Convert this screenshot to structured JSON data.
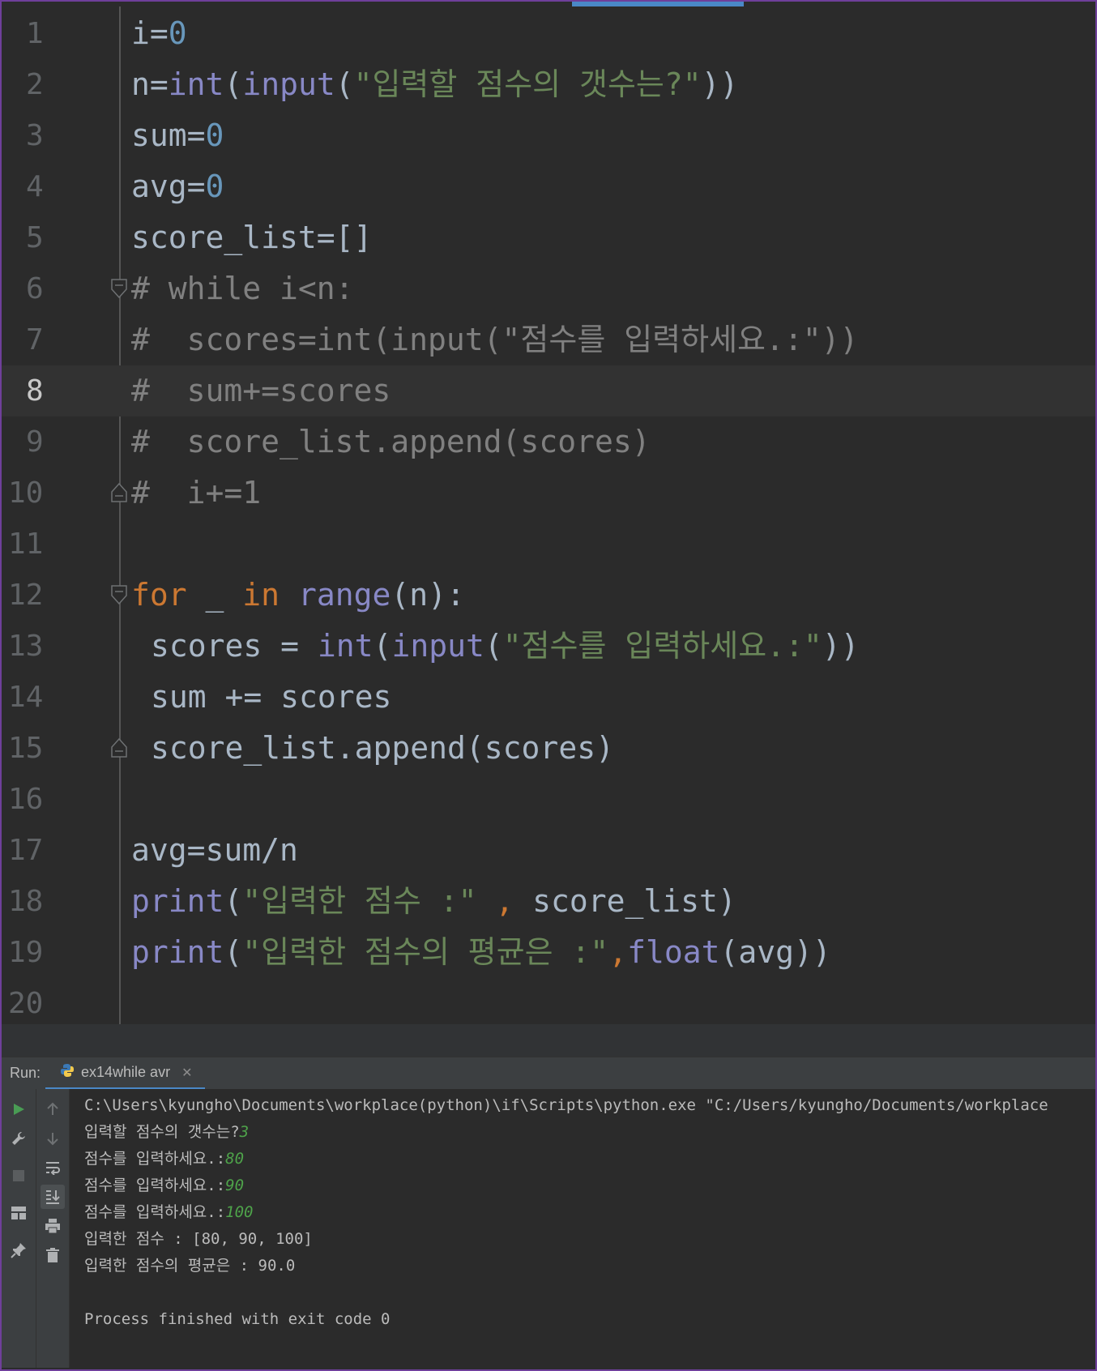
{
  "editor": {
    "current_line": 8,
    "lines": [
      {
        "n": "1",
        "tokens": [
          [
            "i",
            "p"
          ],
          [
            "=",
            "p"
          ],
          [
            "0",
            "num"
          ]
        ]
      },
      {
        "n": "2",
        "tokens": [
          [
            "n",
            "p"
          ],
          [
            "=",
            "p"
          ],
          [
            "int",
            "bi"
          ],
          [
            "(",
            "p"
          ],
          [
            "input",
            "bi"
          ],
          [
            "(",
            "p"
          ],
          [
            "\"입력할 점수의 갯수는?\"",
            "str"
          ],
          [
            "))",
            "p"
          ]
        ]
      },
      {
        "n": "3",
        "tokens": [
          [
            "sum",
            "p"
          ],
          [
            "=",
            "p"
          ],
          [
            "0",
            "num"
          ]
        ]
      },
      {
        "n": "4",
        "tokens": [
          [
            "avg",
            "p"
          ],
          [
            "=",
            "p"
          ],
          [
            "0",
            "num"
          ]
        ]
      },
      {
        "n": "5",
        "tokens": [
          [
            "score_list",
            "p"
          ],
          [
            "=[]",
            "p"
          ]
        ]
      },
      {
        "n": "6",
        "tokens": [
          [
            "# while i<n:",
            "cm"
          ]
        ]
      },
      {
        "n": "7",
        "tokens": [
          [
            "#  scores=int(input(\"점수를 입력하세요.:\"))",
            "cm"
          ]
        ]
      },
      {
        "n": "8",
        "tokens": [
          [
            "#  sum+=scores",
            "cm"
          ]
        ]
      },
      {
        "n": "9",
        "tokens": [
          [
            "#  score_list.append(scores)",
            "cm"
          ]
        ]
      },
      {
        "n": "10",
        "tokens": [
          [
            "#  i+=1",
            "cm"
          ]
        ]
      },
      {
        "n": "11",
        "tokens": []
      },
      {
        "n": "12",
        "tokens": [
          [
            "for",
            "kw"
          ],
          [
            " _ ",
            "p"
          ],
          [
            "in",
            "kw"
          ],
          [
            " ",
            "p"
          ],
          [
            "range",
            "bi"
          ],
          [
            "(n):",
            "p"
          ]
        ]
      },
      {
        "n": "13",
        "indent": true,
        "tokens": [
          [
            "scores = ",
            "p"
          ],
          [
            "int",
            "bi"
          ],
          [
            "(",
            "p"
          ],
          [
            "input",
            "bi"
          ],
          [
            "(",
            "p"
          ],
          [
            "\"점수를 입력하세요.:\"",
            "str"
          ],
          [
            "))",
            "p"
          ]
        ]
      },
      {
        "n": "14",
        "indent": true,
        "tokens": [
          [
            "sum += scores",
            "p"
          ]
        ]
      },
      {
        "n": "15",
        "indent": true,
        "tokens": [
          [
            "score_list.append(scores)",
            "p"
          ]
        ]
      },
      {
        "n": "16",
        "tokens": []
      },
      {
        "n": "17",
        "tokens": [
          [
            "avg=sum/n",
            "p"
          ]
        ]
      },
      {
        "n": "18",
        "tokens": [
          [
            "print",
            "bi"
          ],
          [
            "(",
            "p"
          ],
          [
            "\"입력한 점수 :\"",
            "str"
          ],
          [
            " ",
            "p"
          ],
          [
            ",",
            "kw"
          ],
          [
            " score_list)",
            "p"
          ]
        ]
      },
      {
        "n": "19",
        "tokens": [
          [
            "print",
            "bi"
          ],
          [
            "(",
            "p"
          ],
          [
            "\"입력한 점수의 평균은 :\"",
            "str"
          ],
          [
            ",",
            "kw"
          ],
          [
            "float",
            "bi"
          ],
          [
            "(avg))",
            "p"
          ]
        ]
      },
      {
        "n": "20",
        "tokens": []
      }
    ]
  },
  "run": {
    "label": "Run:",
    "tab_name": "ex14while avr",
    "console": [
      {
        "text": "C:\\Users\\kyungho\\Documents\\workplace(python)\\if\\Scripts\\python.exe \"C:/Users/kyungho/Documents/workplace",
        "input": ""
      },
      {
        "text": "입력할 점수의 갯수는?",
        "input": "3"
      },
      {
        "text": "점수를 입력하세요.:",
        "input": "80"
      },
      {
        "text": "점수를 입력하세요.:",
        "input": "90"
      },
      {
        "text": "점수를 입력하세요.:",
        "input": "100"
      },
      {
        "text": "입력한 점수 : [80, 90, 100]",
        "input": ""
      },
      {
        "text": "입력한 점수의 평균은 : 90.0",
        "input": ""
      },
      {
        "text": "",
        "input": ""
      },
      {
        "text": "Process finished with exit code 0",
        "input": ""
      }
    ]
  },
  "icons": [
    "run-icon",
    "wrench-icon",
    "stop-icon",
    "layout-icon",
    "pin-icon",
    "up-arrow-icon",
    "down-arrow-icon",
    "soft-wrap-icon",
    "scroll-to-end-icon",
    "print-icon",
    "trash-icon",
    "python-file-icon",
    "close-icon"
  ],
  "colors": {
    "keyword": "#cc7832",
    "builtin": "#8888c6",
    "number": "#6897bb",
    "string": "#6a8759",
    "comment": "#808080",
    "plain": "#a9b7c6",
    "console_input": "#4ea34a",
    "frame": "#6f3f9a"
  }
}
